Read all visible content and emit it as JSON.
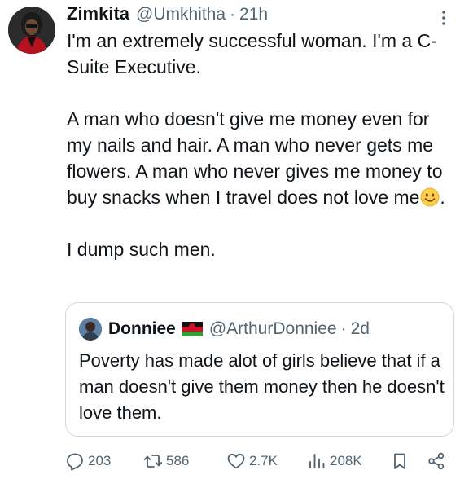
{
  "author": {
    "name": "Zimkita",
    "handle": "@Umkhitha",
    "separator": "·",
    "time": "21h"
  },
  "icons": {
    "more": "more-vertical-icon",
    "emoji": "slightly-smiling-face-emoji",
    "flag": "malawi-flag-emoji"
  },
  "body": {
    "para1": "I'm an extremely successful woman. I'm a C-Suite Executive.",
    "para2": "A man who doesn't give me money even for my nails and hair. A man who never gets me flowers. A man who never gives me money to buy snacks when I travel does not love me",
    "para2_end": ".",
    "para3": "I dump such men."
  },
  "quote": {
    "name": "Donniee",
    "handle": "@ArthurDonniee",
    "separator": "·",
    "time": "2d",
    "text": "Poverty has made alot of girls believe that if a man doesn't give them money then he doesn't love them."
  },
  "actions": {
    "replies": "203",
    "retweets": "586",
    "likes": "2.7K",
    "views": "208K"
  },
  "colors": {
    "text": "#0f1419",
    "secondary": "#536471",
    "border": "#cfd9de"
  }
}
